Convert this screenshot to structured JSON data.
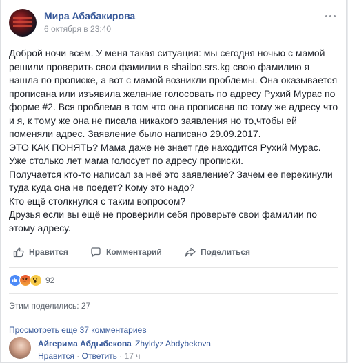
{
  "post": {
    "author": "Мира Абабакирова",
    "time": "6 октября в 23:40",
    "paragraphs": [
      "Доброй ночи всем. У меня такая ситуация: мы сегодня ночью с мамой решили проверить свои фамилии в shailoo.srs.kg свою фамилию я нашла по прописке, а вот с мамой возникли проблемы. Она оказывается прописана или изъявила желание голосовать по адресу Рухий Мурас по форме #2. Вся проблема в том что она прописана по тому же адресу что и я, к тому же она не писала никакого заявления но то,чтобы ей поменяли адрес. Заявление было написано 29.09.2017.",
      "ЭТО КАК ПОНЯТЬ? Мама даже не знает где находится Рухий Мурас.",
      "Уже столько лет мама голосует по адресу прописки.",
      "Получается кто-то написал за неё это заявление? Зачем ее перекинули туда куда она не поедет? Кому это надо?",
      "Кто ещё столкнулся с таким вопросом?",
      "Друзья если вы ещё не проверили себя проверьте свои фамилии по этому адресу."
    ]
  },
  "actions": {
    "like_label": "Нравится",
    "comment_label": "Комментарий",
    "share_label": "Поделиться"
  },
  "reactions": {
    "count": "92",
    "types": [
      "like-icon",
      "angry-icon",
      "wow-icon"
    ]
  },
  "shares_text": "Этим поделились: 27",
  "more_comments": "Просмотреть еще 37 комментариев",
  "comment": {
    "author": "Айгерима Абдыбекова",
    "tagged": "Zhyldyz Abdybekova",
    "like_label": "Нравится",
    "sep1": "·",
    "reply_label": "Ответить",
    "sep2": "·",
    "age": "17 ч"
  },
  "colors": {
    "link": "#365899",
    "meta": "#90949c",
    "action": "#606770"
  }
}
